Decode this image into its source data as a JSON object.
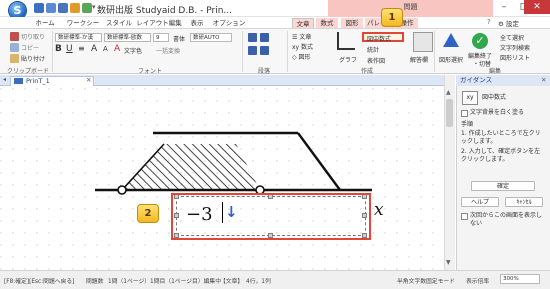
{
  "window": {
    "title": "数研出版 Studyaid D.B. - Prin...",
    "context_title": "問題",
    "minimize": "–",
    "maximize": "□",
    "close": "✕",
    "settings_label": "設定"
  },
  "tabs": [
    "ホーム",
    "ワークシート",
    "スタイル",
    "レイアウト編集",
    "表示",
    "オプション",
    "文章",
    "数式",
    "図形",
    "パレット",
    "操作"
  ],
  "ribbon": {
    "clipboard": {
      "label": "クリップボード",
      "cut": "切り取り",
      "copy": "コピー",
      "paste": "貼り付け"
    },
    "font": {
      "label": "フォント",
      "font_name": "数研標準-か漢",
      "font_name2": "数研標準-欧数",
      "size": "9",
      "typeface_label": "書体",
      "typeface_value": "数研AUTO",
      "char_color": "文字色",
      "spacing": "一括変換"
    },
    "paragraph": {
      "label": "段落"
    },
    "create": {
      "label": "作成",
      "text_item": "文章",
      "math_item": "数式",
      "shape_item": "図形",
      "graph_item": "グラフ",
      "in_figure_math": "図中数式",
      "stats": "統計",
      "table_item": "表作図",
      "answer_grid": "解答欄"
    },
    "edit": {
      "label": "編集",
      "select_shape": "図形選択",
      "complete_edit": "編集終了",
      "switch": "・切替",
      "select_all": "全て選択",
      "find_char": "文字列検索",
      "shape_list": "図形リスト"
    }
  },
  "document": {
    "tab_name": "PrinT_1"
  },
  "equation": {
    "text": "−3",
    "arrow": "↓",
    "x_label": "x"
  },
  "pane": {
    "title": "ガイダンス",
    "item": "図中数式",
    "check_label": "文字背景を白く塗る",
    "steps_title": "手順",
    "step1": "1. 作成したいところで左クリックします。",
    "step2": "2. 入力して、確定ボタンを左クリックします。",
    "confirm": "確定",
    "help": "ヘルプ",
    "cancel": "ｷｬﾝｾﾙ",
    "hide_check": "次回からこの画面を表示しない"
  },
  "status": {
    "left": "[F8:確定][Esc:問題へ戻る]",
    "problem_count": "問題数",
    "problem_number": "1問（1ページ）",
    "question_info": "1問目（1ページ目）編集中",
    "mode": "【文章】",
    "position": "4行，1列",
    "mode_right": "半角文字数固定モード",
    "zoom_label": "表示倍率",
    "zoom_value": "300%"
  },
  "callouts": [
    "1",
    "2"
  ],
  "colors": {
    "accent_red": "#e24638",
    "callout": "#f3b81f",
    "ribbon_bg": "#f7f7f7",
    "context_pink": "#f8c5c0"
  }
}
